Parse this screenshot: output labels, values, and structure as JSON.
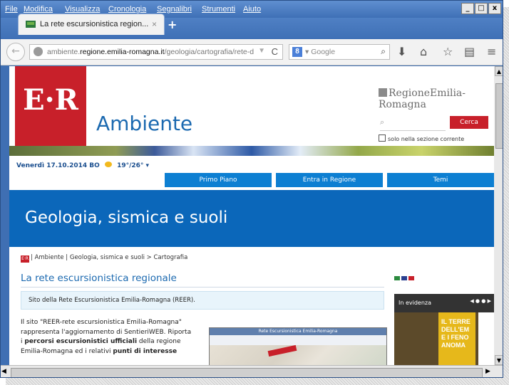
{
  "menubar": {
    "items": [
      "File",
      "Modifica",
      "Visualizza",
      "Cronologia",
      "Segnalibri",
      "Strumenti",
      "Aiuto"
    ]
  },
  "window_buttons": {
    "minimize": "_",
    "maximize": "□",
    "close": "x"
  },
  "tab": {
    "title": "La rete escursionistica region...",
    "close": "×",
    "new": "+"
  },
  "address_bar": {
    "prefix": "ambiente.",
    "domain": "regione.emilia-romagna.it",
    "path": "/geologia/cartografia/rete-de",
    "dropdown": "▼",
    "reload": "C"
  },
  "search_bar": {
    "engine_badge": "8",
    "placeholder": "▾ Google",
    "button": "⌕"
  },
  "toolbar_icons": [
    "download-icon",
    "home-icon",
    "star-icon",
    "reading-list-icon",
    "menu-icon"
  ],
  "site": {
    "logo": "E·R",
    "section": "Ambiente",
    "region_logo": "RegioneEmilia-Romagna",
    "search_placeholder": "⌕",
    "search_button": "Cerca",
    "only_current_section": "solo nella sezione corrente",
    "date": "Venerdì 17.10.2014",
    "city": "BO",
    "temp": "19°/26°",
    "nav_tabs": [
      "Primo Piano",
      "Entra in Regione",
      "Temi"
    ],
    "hero_title": "Geologia, sismica e suoli",
    "breadcrumb_logo": "E·R",
    "breadcrumb": "| Ambiente | Geologia, sismica e suoli > Cartografia",
    "page_title": "La rete escursionistica regionale",
    "info_text": "Sito della Rete Escursionistica Emilia-Romagna (REER).",
    "body_line1": "Il sito \"REER-rete escursionistica Emilia-Romagna\"",
    "body_line2": "rappresenta l'aggiornamento di SentieriWEB. Riporta",
    "body_line3_a": "i ",
    "body_line3_b": "percorsi escursionistici ufficiali",
    "body_line3_c": " della regione",
    "body_line4_a": "Emilia-Romagna ed i relativi ",
    "body_line4_b": "punti di interesse",
    "screenshot_title": "Rete Escursionistica Emilia-Romagna",
    "evidenza_title": "In evidenza",
    "evidenza_pager": "◀  ● ● ▶",
    "evidenza_text": "IL TERRE\nDELL'EM\nE I FENO\nANOMA"
  }
}
